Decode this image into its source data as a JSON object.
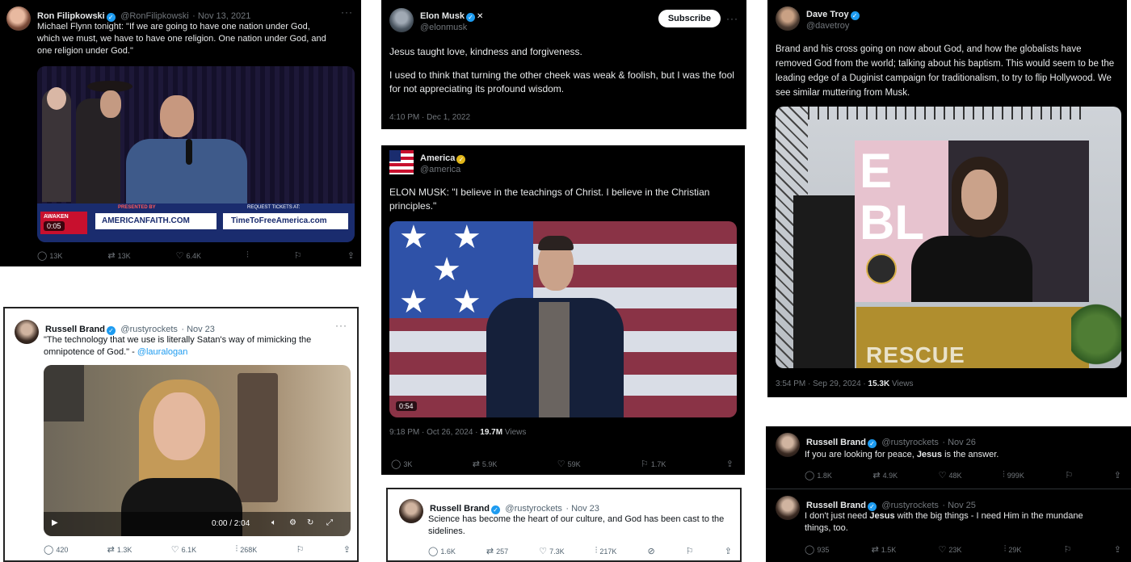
{
  "tweets": {
    "flipkowski": {
      "name": "Ron Filipkowski",
      "handle": "@RonFilipkowski",
      "date": "· Nov 13, 2021",
      "text_line1": "Michael Flynn tonight: \"If we are going to have one nation under God,",
      "text_line2": "which we must, we have to have one religion. One nation under God, and",
      "text_line3": "one religion under God.\"",
      "banner_sub": "PRESENTED BY",
      "banner_request": "REQUEST TICKETS AT:",
      "banner_awaken": "AWAKEN",
      "banner_site1": "AMERICANFAITH.COM",
      "banner_site2": "TimeToFreeAmerica.com",
      "duration": "0:05",
      "actions": {
        "replies": "13K",
        "reposts": "13K",
        "likes": "6.4K"
      }
    },
    "musk": {
      "name": "Elon Musk",
      "handle": "@elonmusk",
      "subscribe": "Subscribe",
      "para1": "Jesus taught love, kindness and forgiveness.",
      "para2": "I used to think that turning the other cheek was weak & foolish, but I was the fool for not appreciating its profound wisdom.",
      "meta": "4:10 PM · Dec 1, 2022"
    },
    "america": {
      "name": "America",
      "handle": "@america",
      "text": "ELON MUSK: \"I believe in the teachings of Christ. I believe in the Christian principles.\"",
      "duration": "0:54",
      "meta_time": "9:18 PM · Oct 26, 2024 ·",
      "views": "19.7M",
      "views_label": "Views",
      "actions": {
        "replies": "3K",
        "reposts": "5.9K",
        "likes": "59K",
        "bookmarks": "1.7K"
      }
    },
    "troy": {
      "name": "Dave Troy",
      "handle": "@davetroy",
      "text": "Brand and his cross going on now about God, and how the globalists have removed God from the world; talking about his baptism. This would seem to be the leading edge of a Duginist campaign for traditionalism, to try to flip Hollywood. We see similar muttering from Musk.",
      "screen_text": "E BL",
      "podium_text": "RESCUE",
      "meta_time": "3:54 PM · Sep 29, 2024 ·",
      "views": "15.3K",
      "views_label": "Views"
    },
    "brand_tech": {
      "name": "Russell Brand",
      "handle": "@rustyrockets",
      "date": "· Nov 23",
      "text": "\"The technology that we use is literally Satan's way of mimicking the omnipotence of God.\" - ",
      "mention": "@lauralogan",
      "time_display": "0:00 / 2:04",
      "actions": {
        "replies": "420",
        "reposts": "1.3K",
        "likes": "6.1K",
        "views": "268K"
      }
    },
    "brand_science": {
      "name": "Russell Brand",
      "handle": "@rustyrockets",
      "date": "· Nov 23",
      "text": "Science has become the heart of our culture, and God has been cast to the sidelines.",
      "actions": {
        "replies": "1.6K",
        "reposts": "257",
        "likes": "7.3K",
        "views": "217K"
      }
    },
    "brand_peace": {
      "name": "Russell Brand",
      "handle": "@rustyrockets",
      "date": "· Nov 26",
      "text_before": "If you are looking for peace, ",
      "text_bold": "Jesus",
      "text_after": " is the answer.",
      "actions": {
        "replies": "1.8K",
        "reposts": "4.9K",
        "likes": "48K",
        "views": "999K"
      }
    },
    "brand_need": {
      "name": "Russell Brand",
      "handle": "@rustyrockets",
      "date": "· Nov 25",
      "text_before": "I don't just need ",
      "text_bold": "Jesus",
      "text_after": " with the big things - I need Him in the mundane things, too.",
      "actions": {
        "replies": "935",
        "reposts": "1.5K",
        "likes": "23K",
        "views": "29K"
      }
    }
  },
  "icons": {
    "verified": "verified-badge-icon",
    "reply": "reply-icon",
    "repost": "repost-icon",
    "like": "like-icon",
    "views": "views-icon",
    "bookmark": "bookmark-icon",
    "share": "share-icon",
    "more": "more-icon"
  },
  "colors": {
    "verified": "#1d9bf0",
    "gold_badge": "#e2b719",
    "link": "#1d9bf0"
  }
}
